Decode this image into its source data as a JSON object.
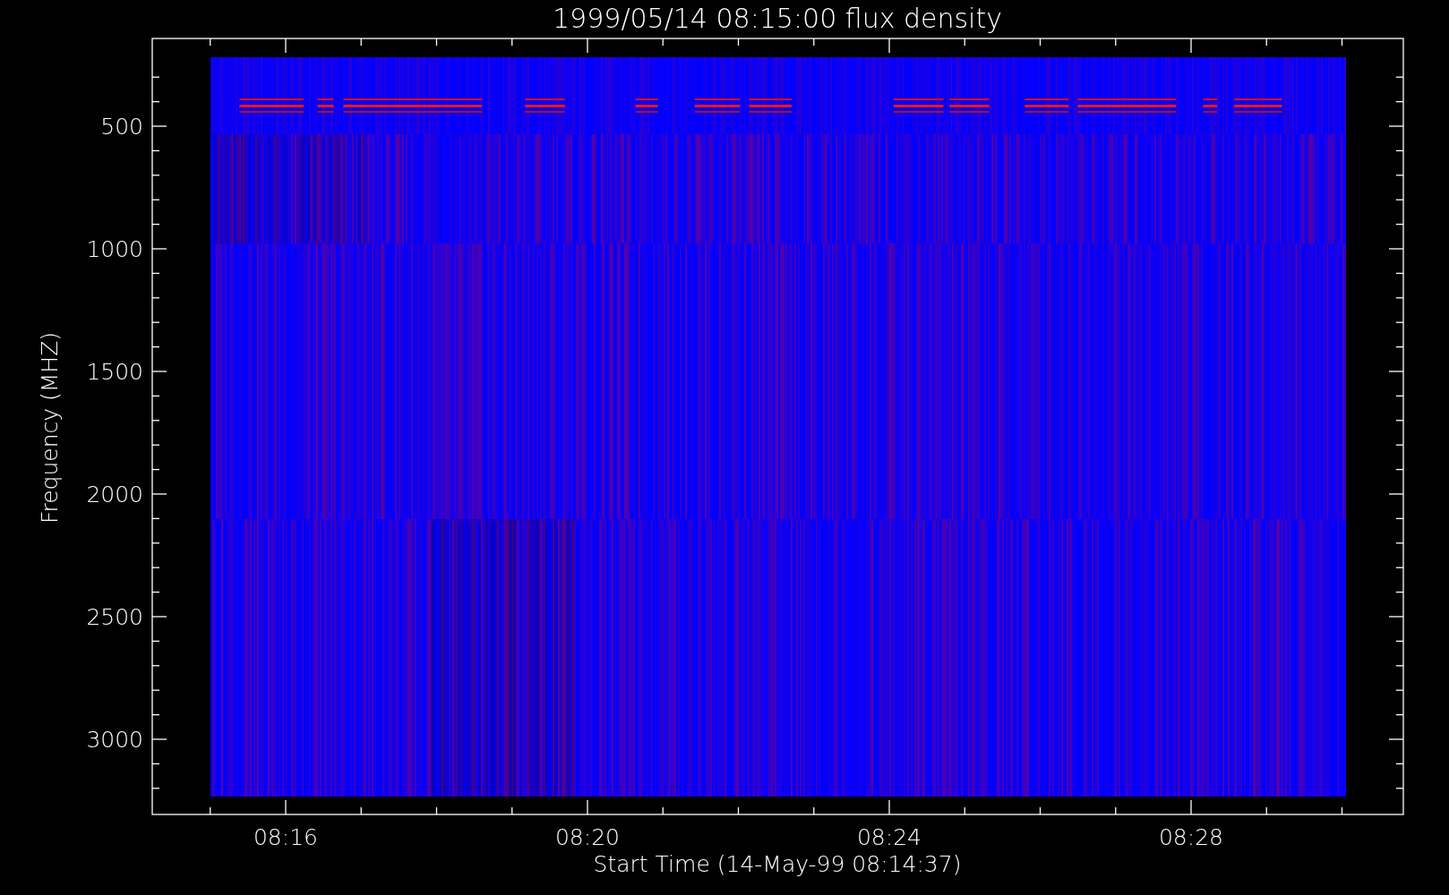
{
  "title": "1999/05/14 08:15:00 flux density",
  "x_axis": {
    "label": "Start Time (14-May-99 08:14:37)",
    "ticks": [
      "08:16",
      "08:20",
      "08:24",
      "08:28"
    ]
  },
  "y_axis": {
    "label": "Frequency (MHZ)",
    "ticks": [
      "500",
      "1000",
      "1500",
      "2000",
      "2500",
      "3000"
    ]
  }
}
